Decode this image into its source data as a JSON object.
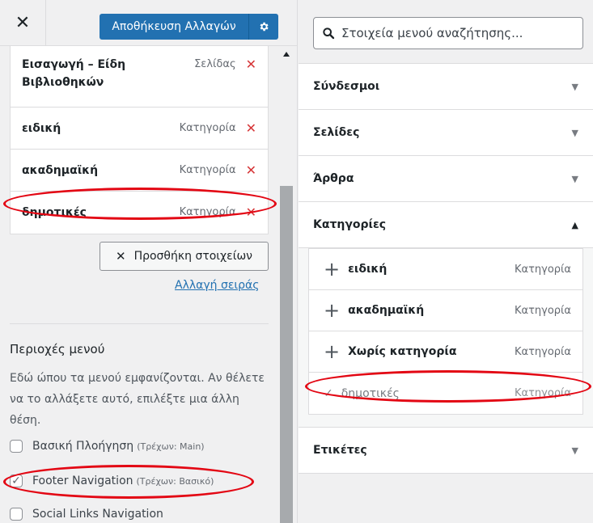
{
  "topbar": {
    "close_glyph": "✕",
    "save_label": "Αποθήκευση Αλλαγών",
    "gear_icon": "gear-icon"
  },
  "menu_items": [
    {
      "title": "Εισαγωγή – Είδη Βιβλιοθηκών",
      "type": "Σελίδας"
    },
    {
      "title": "ειδική",
      "type": "Κατηγορία"
    },
    {
      "title": "ακαδημαϊκή",
      "type": "Κατηγορία"
    },
    {
      "title": "δημοτικές",
      "type": "Κατηγορία"
    }
  ],
  "remove_glyph": "✕",
  "actions": {
    "add_items_label": "Προσθήκη στοιχείων",
    "reorder_label": "Αλλαγή σειράς"
  },
  "locations": {
    "title": "Περιοχές μενού",
    "description": "Εδώ ώπου τα μενού εμφανίζονται. Αν θέλετε να το αλλάξετε αυτό, επιλέξτε μια άλλη θέση.",
    "items": [
      {
        "label": "Βασική Πλοήγηση",
        "current": "(Τρέχων: Main)",
        "checked": false
      },
      {
        "label": "Footer Navigation",
        "current": "(Τρέχων: Βασικό)",
        "checked": true
      },
      {
        "label": "Social Links Navigation",
        "current": "",
        "checked": false
      }
    ]
  },
  "search": {
    "placeholder": "Στοιχεία μενού αναζήτησης..."
  },
  "accordion": {
    "links": "Σύνδεσμοι",
    "pages": "Σελίδες",
    "posts": "Άρθρα",
    "categories": "Κατηγορίες",
    "tags": "Ετικέτες"
  },
  "categories": [
    {
      "name": "ειδική",
      "type": "Κατηγορία",
      "added": false
    },
    {
      "name": "ακαδημαϊκή",
      "type": "Κατηγορία",
      "added": false
    },
    {
      "name": "Χωρίς κατηγορία",
      "type": "Κατηγορία",
      "added": false
    },
    {
      "name": "δημοτικές",
      "type": "Κατηγορία",
      "added": true
    }
  ],
  "colors": {
    "primary": "#2271b1",
    "remove": "#d63638",
    "annotation": "#e30613"
  }
}
